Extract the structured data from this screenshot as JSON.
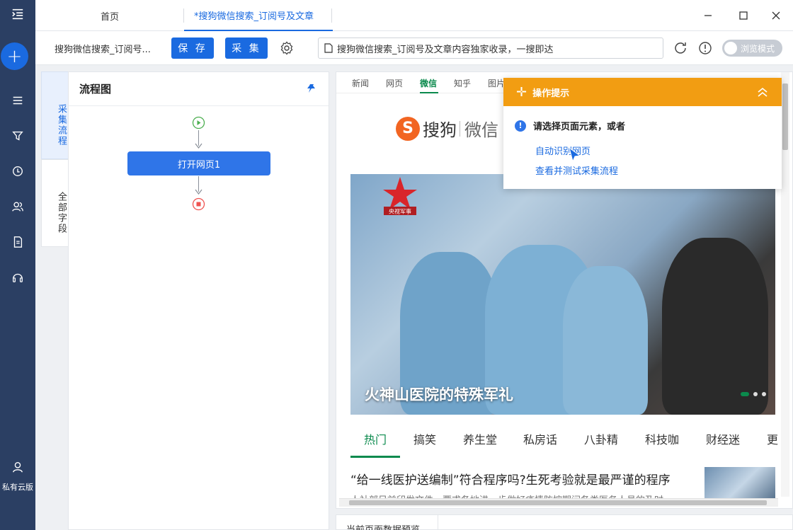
{
  "tabs": {
    "home": "首页",
    "active": "*搜狗微信搜索_订阅号及文章"
  },
  "toolbar": {
    "task_title": "搜狗微信搜索_订阅号...",
    "save_label": "保 存",
    "collect_label": "采 集",
    "url_text": "搜狗微信搜索_订阅号及文章内容独家收录，一搜即达",
    "browse_mode_label": "浏览模式"
  },
  "rail": {
    "private_cloud_label": "私有云版"
  },
  "side_tabs": {
    "flow": "采集流程",
    "fields": "全部字段"
  },
  "flow": {
    "title": "流程图",
    "open_page_node": "打开网页1"
  },
  "site": {
    "nav": [
      "新闻",
      "网页",
      "微信",
      "知乎",
      "图片"
    ],
    "nav_active": "微信",
    "logo_mark": "S",
    "logo_text1": "搜狗",
    "logo_text2": "微信",
    "hero_caption": "火神山医院的特殊军礼",
    "cctv_label": "央视军事",
    "categories": [
      "热门",
      "搞笑",
      "养生堂",
      "私房话",
      "八卦精",
      "科技咖",
      "财经迷",
      "更"
    ],
    "category_active": "热门",
    "headline": "“给一线医护送编制”符合程序吗?生死考验就是最严谨的程序",
    "subline": "人社部日前印发文件，要求各地进一步做好疫情防控期间各类医务人员的及时"
  },
  "tips": {
    "title": "操作提示",
    "prompt": "请选择页面元素，或者",
    "link_auto": "自动识别网页",
    "link_test": "查看并测试采集流程"
  },
  "preview": {
    "label": "当前页面数据预览"
  },
  "colors": {
    "rail_bg": "#2b3f63",
    "primary": "#1a6ae0",
    "tips_orange": "#f29d12",
    "sogou_green": "#0b8a4d",
    "sogou_orange": "#f26522"
  }
}
